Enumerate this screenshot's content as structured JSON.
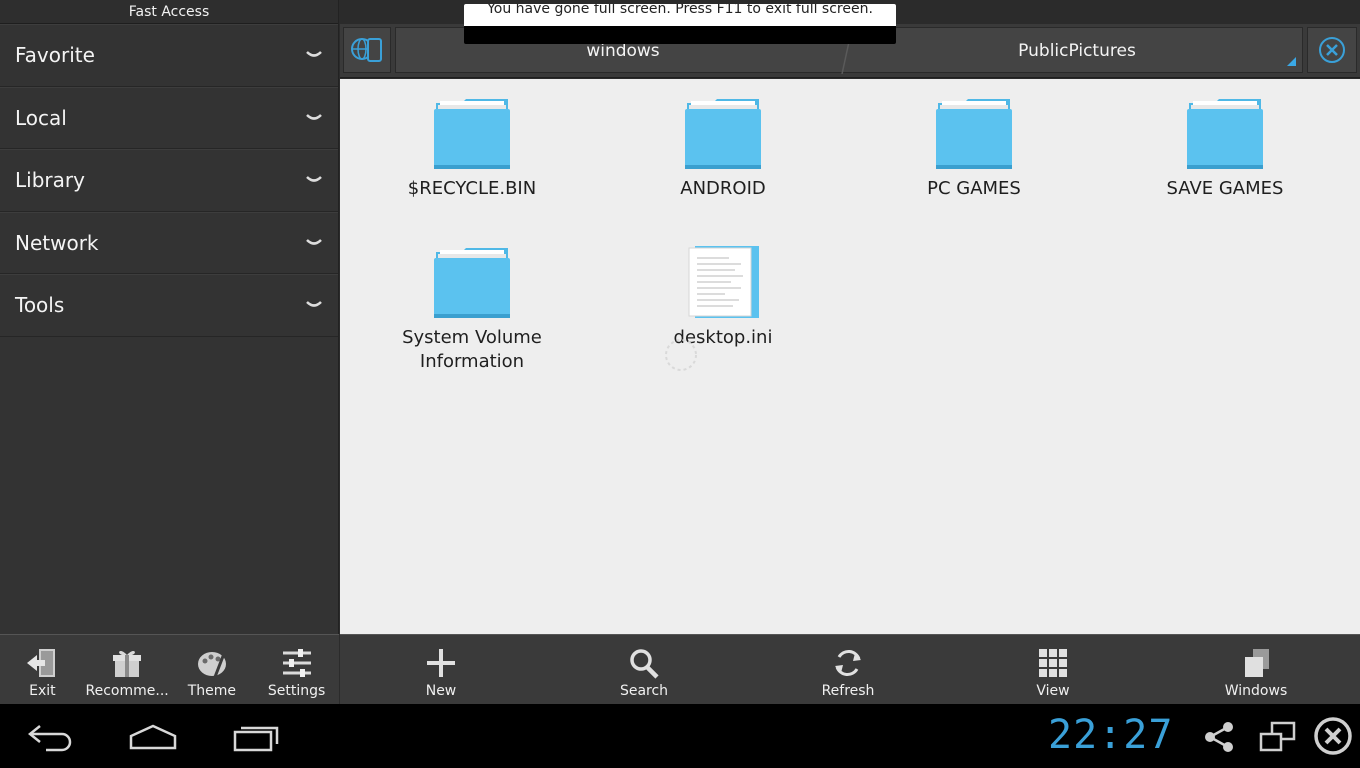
{
  "fullscreen_notice": "You have gone full screen. Press F11 to exit full screen.",
  "sidebar": {
    "title": "Fast Access",
    "sections": [
      {
        "label": "Favorite"
      },
      {
        "label": "Local"
      },
      {
        "label": "Library"
      },
      {
        "label": "Network"
      },
      {
        "label": "Tools"
      }
    ],
    "toolbar": [
      {
        "label": "Exit",
        "icon": "exit-icon"
      },
      {
        "label": "Recomme...",
        "icon": "gift-icon"
      },
      {
        "label": "Theme",
        "icon": "theme-icon"
      },
      {
        "label": "Settings",
        "icon": "settings-icon"
      }
    ]
  },
  "pathbar": {
    "tab1": "windows",
    "tab2": "PublicPictures"
  },
  "files": [
    {
      "name": "$RECYCLE.BIN",
      "type": "folder"
    },
    {
      "name": "ANDROID",
      "type": "folder"
    },
    {
      "name": "PC GAMES",
      "type": "folder"
    },
    {
      "name": "SAVE GAMES",
      "type": "folder"
    },
    {
      "name": "System Volume\nInformation",
      "type": "folder"
    },
    {
      "name": "desktop.ini",
      "type": "document"
    }
  ],
  "main_toolbar": [
    {
      "label": "New",
      "icon": "plus-icon"
    },
    {
      "label": "Search",
      "icon": "search-icon"
    },
    {
      "label": "Refresh",
      "icon": "refresh-icon"
    },
    {
      "label": "View",
      "icon": "grid-icon"
    },
    {
      "label": "Windows",
      "icon": "windows-stack-icon"
    }
  ],
  "system_bar": {
    "clock": "22:27"
  },
  "colors": {
    "accent": "#3aa0d8",
    "folder": "#5bc2ef",
    "content_bg": "#eeeeee",
    "panel_bg": "#333333"
  }
}
